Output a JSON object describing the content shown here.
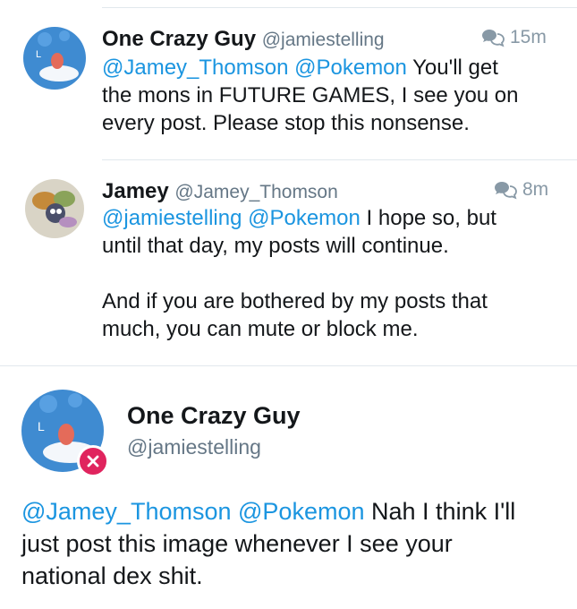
{
  "tweets": [
    {
      "name": "One Crazy Guy",
      "handle": "@jamiestelling",
      "time": "15m",
      "mentions": [
        "@Jamey_Thomson",
        "@Pokemon"
      ],
      "text_line1_rest": "You'll get",
      "text_line2": "the mons in FUTURE GAMES, I see you on",
      "text_line3": "every post. Please stop this nonsense."
    },
    {
      "name": "Jamey",
      "handle": "@Jamey_Thomson",
      "time": "8m",
      "mentions": [
        "@jamiestelling",
        "@Pokemon"
      ],
      "text_line1_rest": "I hope so, but",
      "text_line2": "until that day, my posts will continue.",
      "text_line3": "And if you are bothered by my posts that",
      "text_line4": "much, you can mute or block me."
    }
  ],
  "focused": {
    "name": "One Crazy Guy",
    "handle": "@jamiestelling",
    "mentions": [
      "@Jamey_Thomson",
      "@Pokemon"
    ],
    "text_line1_rest": "Nah I think I'll",
    "text_line2": "just post this image whenever I see your",
    "text_line3": "national dex shit."
  },
  "icons": {
    "reply_thread": "conversation-icon",
    "blocked": "blocked-badge-icon"
  },
  "colors": {
    "mention": "#1b95e0",
    "muted": "#8899a6",
    "badge": "#e0245e"
  }
}
